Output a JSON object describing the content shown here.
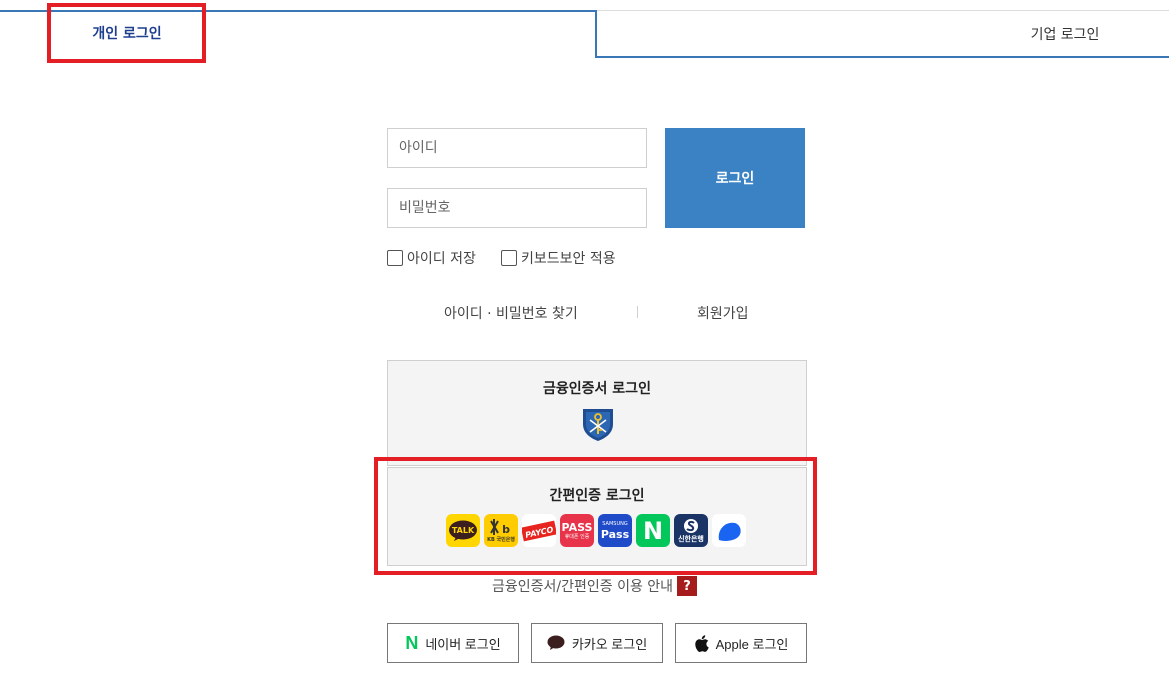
{
  "tabs": {
    "personal": "개인 로그인",
    "corporate": "기업 로그인"
  },
  "form": {
    "id_placeholder": "아이디",
    "pw_placeholder": "비밀번호",
    "login_label": "로그인",
    "save_id_label": "아이디 저장",
    "keyboard_security_label": "키보드보안 적용",
    "find_label": "아이디 · 비밀번호 찾기",
    "join_label": "회원가입"
  },
  "cert": {
    "financial_title": "금융인증서 로그인",
    "simple_title": "간편인증 로그인",
    "providers": [
      {
        "name": "kakao",
        "label": "TALK"
      },
      {
        "name": "kb",
        "label": "KB 국민은행"
      },
      {
        "name": "payco",
        "label": "PAYCO"
      },
      {
        "name": "pass",
        "label": "PASS",
        "sub": "휴대폰 인증"
      },
      {
        "name": "samsung-pass",
        "label": "Pass",
        "sub": "SAMSUNG"
      },
      {
        "name": "naver",
        "label": "N"
      },
      {
        "name": "shinhan",
        "label": "신한은행"
      },
      {
        "name": "toss",
        "label": ""
      }
    ],
    "guide_label": "금융인증서/간편인증 이용 안내",
    "help_label": "?"
  },
  "social": {
    "naver": "네이버 로그인",
    "kakao": "카카오 로그인",
    "apple": "Apple 로그인"
  },
  "colors": {
    "tab_accent": "#3a77b7",
    "login_button": "#3a82c4",
    "highlight": "#e31e25",
    "help_icon": "#a61b1b"
  }
}
